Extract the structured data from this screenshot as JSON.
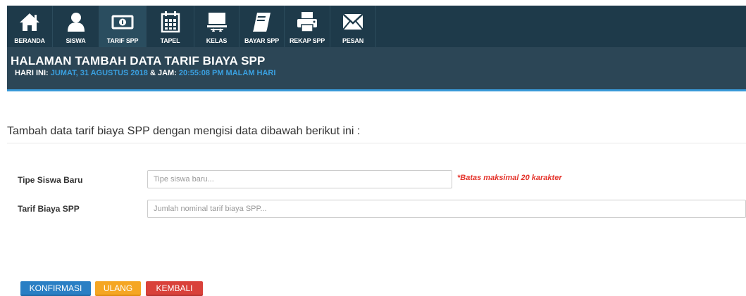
{
  "nav": {
    "items": [
      {
        "label": "BERANDA",
        "icon": "home-icon"
      },
      {
        "label": "SISWA",
        "icon": "user-icon"
      },
      {
        "label": "TARIF SPP",
        "icon": "money-icon"
      },
      {
        "label": "TAPEL",
        "icon": "calendar-icon"
      },
      {
        "label": "KELAS",
        "icon": "classroom-icon"
      },
      {
        "label": "BAYAR SPP",
        "icon": "book-icon"
      },
      {
        "label": "REKAP SPP",
        "icon": "print-icon"
      },
      {
        "label": "PESAN",
        "icon": "envelope-icon"
      }
    ],
    "active_index": 2
  },
  "header": {
    "title": "HALAMAN TAMBAH DATA TARIF BIAYA SPP",
    "date_prefix": "HARI INI:",
    "date_value": "JUMAT, 31 AGUSTUS 2018",
    "time_prefix": "& JAM:",
    "time_value": "20:55:08 PM MALAM HARI"
  },
  "form": {
    "intro": "Tambah data tarif biaya SPP dengan mengisi data dibawah berikut ini :",
    "tipe_label": "Tipe Siswa Baru",
    "tipe_placeholder": "Tipe siswa baru...",
    "tipe_value": "",
    "tipe_note": "*Batas maksimal 20 karakter",
    "tarif_label": "Tarif Biaya SPP",
    "tarif_placeholder": "Jumlah nominal tarif biaya SPP...",
    "tarif_value": ""
  },
  "buttons": {
    "confirm": "KONFIRMASI",
    "reset": "ULANG",
    "back": "KEMBALI"
  },
  "colors": {
    "nav_bg": "#1e3a4a",
    "header_bg": "#2c4656",
    "accent": "#3a9ad9",
    "note_red": "#e4342c",
    "btn_blue": "#2a7fc4",
    "btn_orange": "#f5a623",
    "btn_red": "#d9413a"
  }
}
